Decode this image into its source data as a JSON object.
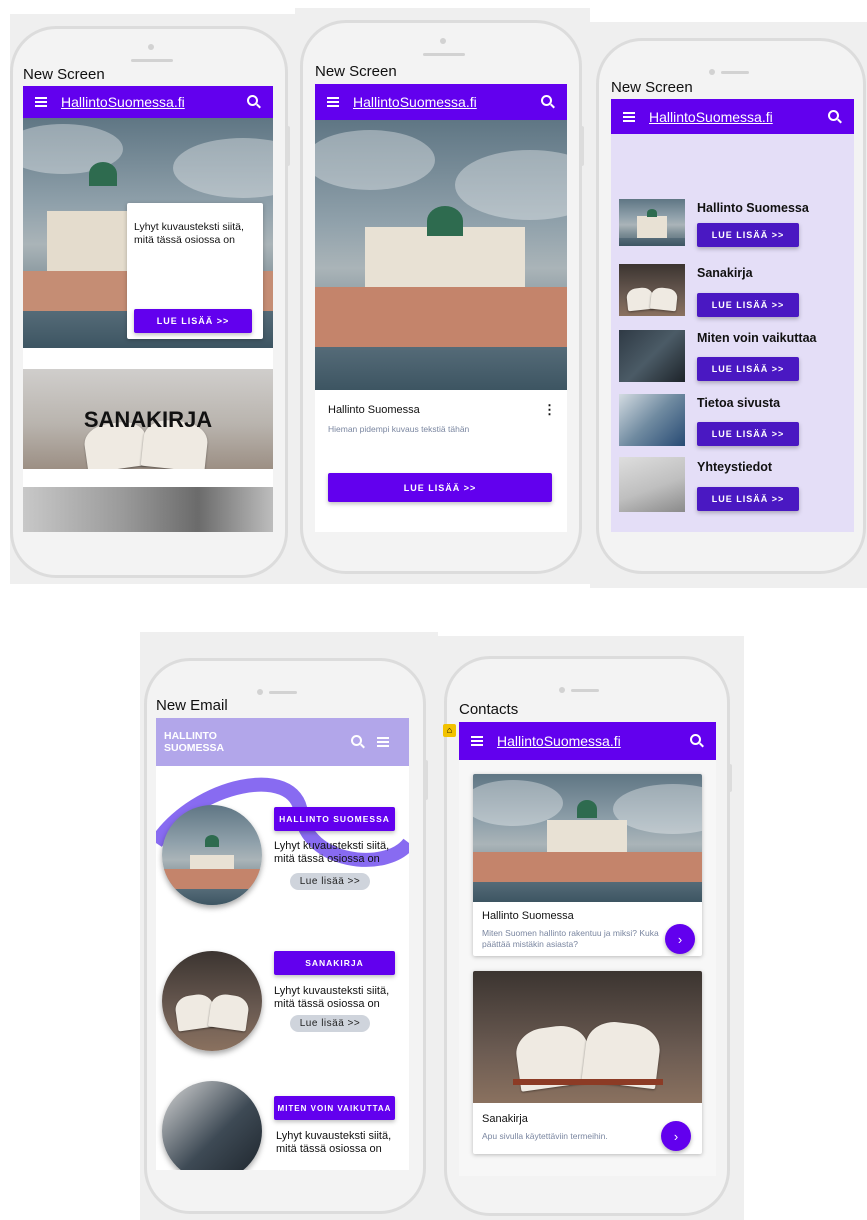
{
  "screens": [
    {
      "title": "New Screen",
      "appbar": {
        "brand": "HallintoSuomessa.fi"
      },
      "hero_card": {
        "text": "Lyhyt kuvausteksti siitä, mitä tässä osiossa on",
        "button": "LUE LISÄÄ >>"
      },
      "banner": {
        "label": "SANAKIRJA"
      }
    },
    {
      "title": "New Screen",
      "appbar": {
        "brand": "HallintoSuomessa.fi"
      },
      "card": {
        "title": "Hallinto Suomessa",
        "subtitle": "Hieman pidempi kuvaus tekstiä tähän",
        "button": "LUE LISÄÄ >>"
      }
    },
    {
      "title": "New Screen",
      "appbar": {
        "brand": "HallintoSuomessa.fi"
      },
      "items": [
        {
          "title": "Hallinto Suomessa",
          "button": "LUE LISÄÄ >>"
        },
        {
          "title": "Sanakirja",
          "button": "LUE LISÄÄ >>"
        },
        {
          "title": "Miten voin vaikuttaa",
          "button": "LUE LISÄÄ >>"
        },
        {
          "title": "Tietoa sivusta",
          "button": "LUE LISÄÄ >>"
        },
        {
          "title": "Yhteystiedot",
          "button": "LUE LISÄÄ >>"
        }
      ]
    },
    {
      "title": "New Email",
      "appbar": {
        "brand_line1": "HALLINTO",
        "brand_line2": "SUOMESSA"
      },
      "sections": [
        {
          "tag": "HALLINTO SUOMESSA",
          "text": "Lyhyt kuvausteksti siitä, mitä tässä osiossa on",
          "button": "Lue lisää >>"
        },
        {
          "tag": "SANAKIRJA",
          "text": "Lyhyt kuvausteksti siitä, mitä tässä osiossa on",
          "button": "Lue lisää >>"
        },
        {
          "tag": "MITEN VOIN VAIKUTTAA",
          "text": "Lyhyt kuvausteksti siitä, mitä tässä osiossa on"
        }
      ]
    },
    {
      "title": "Contacts",
      "appbar": {
        "brand": "HallintoSuomessa.fi"
      },
      "cards": [
        {
          "title": "Hallinto Suomessa",
          "subtitle": "Miten Suomen hallinto rakentuu ja miksi? Kuka päättää mistäkin asiasta?",
          "arrow": "›"
        },
        {
          "title": "Sanakirja",
          "subtitle": "Apu sivulla käytettäviin termeihin.",
          "arrow": "›"
        }
      ]
    }
  ],
  "colors": {
    "primary": "#6200ee",
    "dark_button": "#4a18c2",
    "lavender": "#e4def7",
    "light_purple_bar": "#b2a6ea"
  },
  "icons": [
    "menu-icon",
    "search-icon",
    "home-marker-icon"
  ]
}
